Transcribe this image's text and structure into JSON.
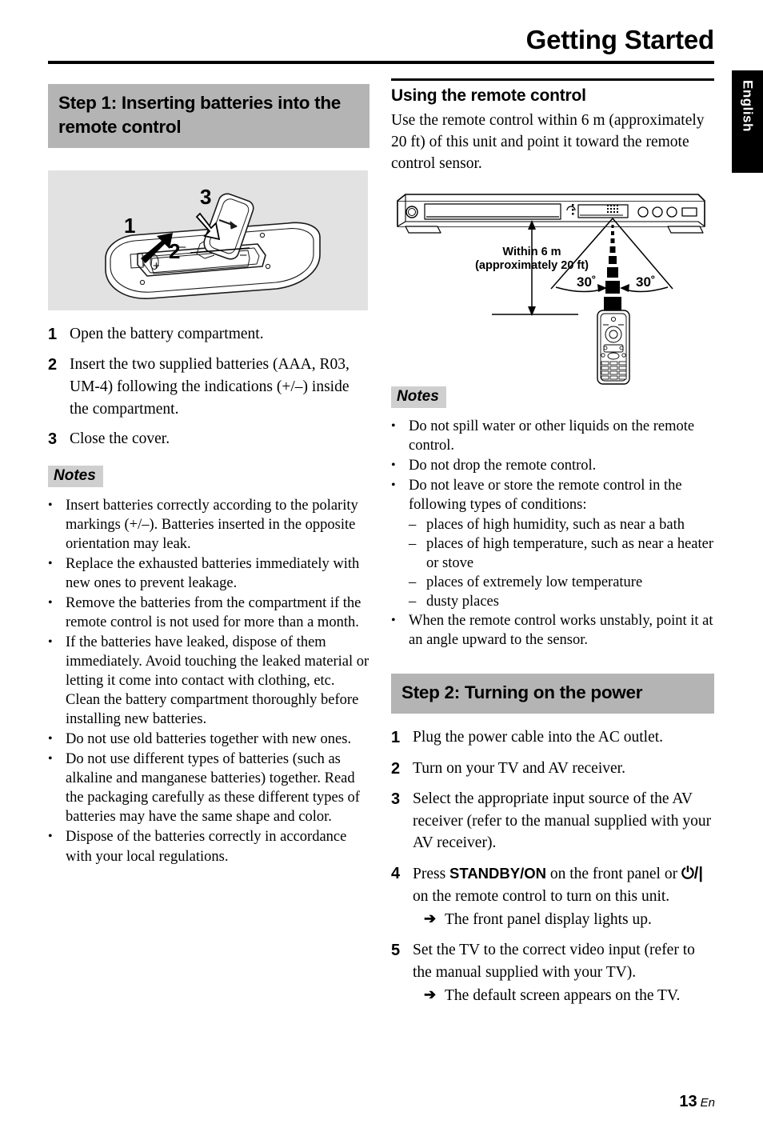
{
  "header": {
    "title": "Getting Started",
    "side_tab": "English",
    "page_number": "13",
    "page_lang": "En"
  },
  "left_column": {
    "step_banner": "Step 1: Inserting batteries into the remote control",
    "figure": {
      "name": "battery-compartment-diagram",
      "callouts": [
        "1",
        "2",
        "3"
      ],
      "polarity_marks": [
        "+",
        "–"
      ]
    },
    "steps": [
      {
        "num": "1",
        "text": "Open the battery compartment."
      },
      {
        "num": "2",
        "text": "Insert the two supplied batteries (AAA, R03, UM-4) following the indications (+/–) inside the compartment."
      },
      {
        "num": "3",
        "text": "Close the cover."
      }
    ],
    "notes_label": "Notes",
    "notes": [
      "Insert batteries correctly according to the polarity markings (+/–). Batteries inserted in the opposite orientation may leak.",
      "Replace the exhausted batteries immediately with new ones to prevent leakage.",
      "Remove the batteries from the compartment if the remote control is not used for more than a month.",
      "If the batteries have leaked, dispose of them immediately. Avoid touching the leaked material or letting it come into contact with clothing, etc. Clean the battery compartment thoroughly before installing new batteries.",
      "Do not use old batteries together with new ones.",
      "Do not use different types of batteries (such as alkaline and manganese batteries) together. Read the packaging carefully as these different types of batteries may have the same shape and color.",
      "Dispose of the batteries correctly in accordance with your local regulations."
    ]
  },
  "right_column": {
    "sub_heading": "Using the remote control",
    "intro": "Use the remote control within 6 m (approximately 20 ft) of this unit and point it toward the remote control sensor.",
    "figure": {
      "name": "remote-range-diagram",
      "distance_label_line1": "Within 6 m",
      "distance_label_line2": "(approximately 20 ft)",
      "angle_left": "30˚",
      "angle_right": "30˚"
    },
    "notes_label": "Notes",
    "notes": [
      {
        "text": "Do not spill water or other liquids on the remote control."
      },
      {
        "text": "Do not drop the remote control."
      },
      {
        "text": "Do not leave or store the remote control in the following types of conditions:",
        "sub": [
          "places of high humidity, such as near a bath",
          "places of high temperature, such as near a heater or stove",
          "places of extremely low temperature",
          "dusty places"
        ]
      },
      {
        "text": "When the remote control works unstably, point it at an angle upward to the sensor."
      }
    ],
    "step_banner": "Step 2: Turning on the power",
    "steps": [
      {
        "num": "1",
        "text": "Plug the power cable into the AC outlet."
      },
      {
        "num": "2",
        "text": "Turn on your TV and AV receiver."
      },
      {
        "num": "3",
        "text": "Select the appropriate input source of the AV receiver (refer to the manual supplied with your AV receiver)."
      },
      {
        "num": "4",
        "pre": "Press ",
        "bold": "STANDBY/ON",
        "mid": " on the front panel or ",
        "symbol": "⏻/|",
        "post": " on the remote control to turn on this unit.",
        "arrow": "➔",
        "arrow_text": "The front panel display lights up."
      },
      {
        "num": "5",
        "text": "Set the TV to the correct video input (refer to the manual supplied with your TV).",
        "arrow": "➔",
        "arrow_text": "The default screen appears on the TV."
      }
    ]
  },
  "colors": {
    "banner_gray": "#b4b4b4",
    "notes_gray": "#cfcfcf",
    "figure_gray": "#e2e2e2",
    "rule_black": "#000000"
  }
}
